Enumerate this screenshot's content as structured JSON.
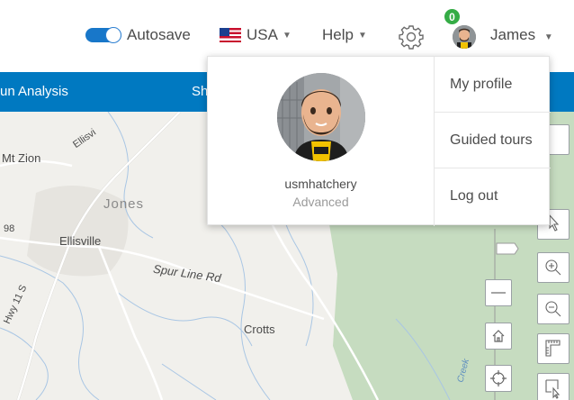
{
  "header": {
    "autosave_label": "Autosave",
    "country_label": "USA",
    "help_label": "Help",
    "notification_count": "0",
    "user_name": "James",
    "autosave_on": true
  },
  "ribbon": {
    "item1": "un Analysis",
    "item2": "Sh"
  },
  "map": {
    "labels": {
      "ellisville_road": "Ellisvi",
      "mt_zion": "Mt Zion",
      "jones": "Jones",
      "num98": "98",
      "ellisville": "Ellisville",
      "spur_line": "Spur Line Rd",
      "hwy": "Hwy 11 S",
      "crotts": "Crotts",
      "creek": "Creek"
    }
  },
  "profile_menu": {
    "username": "usmhatchery",
    "level": "Advanced",
    "items": [
      "My profile",
      "Guided tours",
      "Log out"
    ],
    "avatar_badge": "USM"
  },
  "colors": {
    "ribbon": "#0079c1",
    "toggle": "#1877c9",
    "notification": "#35ac46",
    "forest": "#c6dcc0"
  }
}
